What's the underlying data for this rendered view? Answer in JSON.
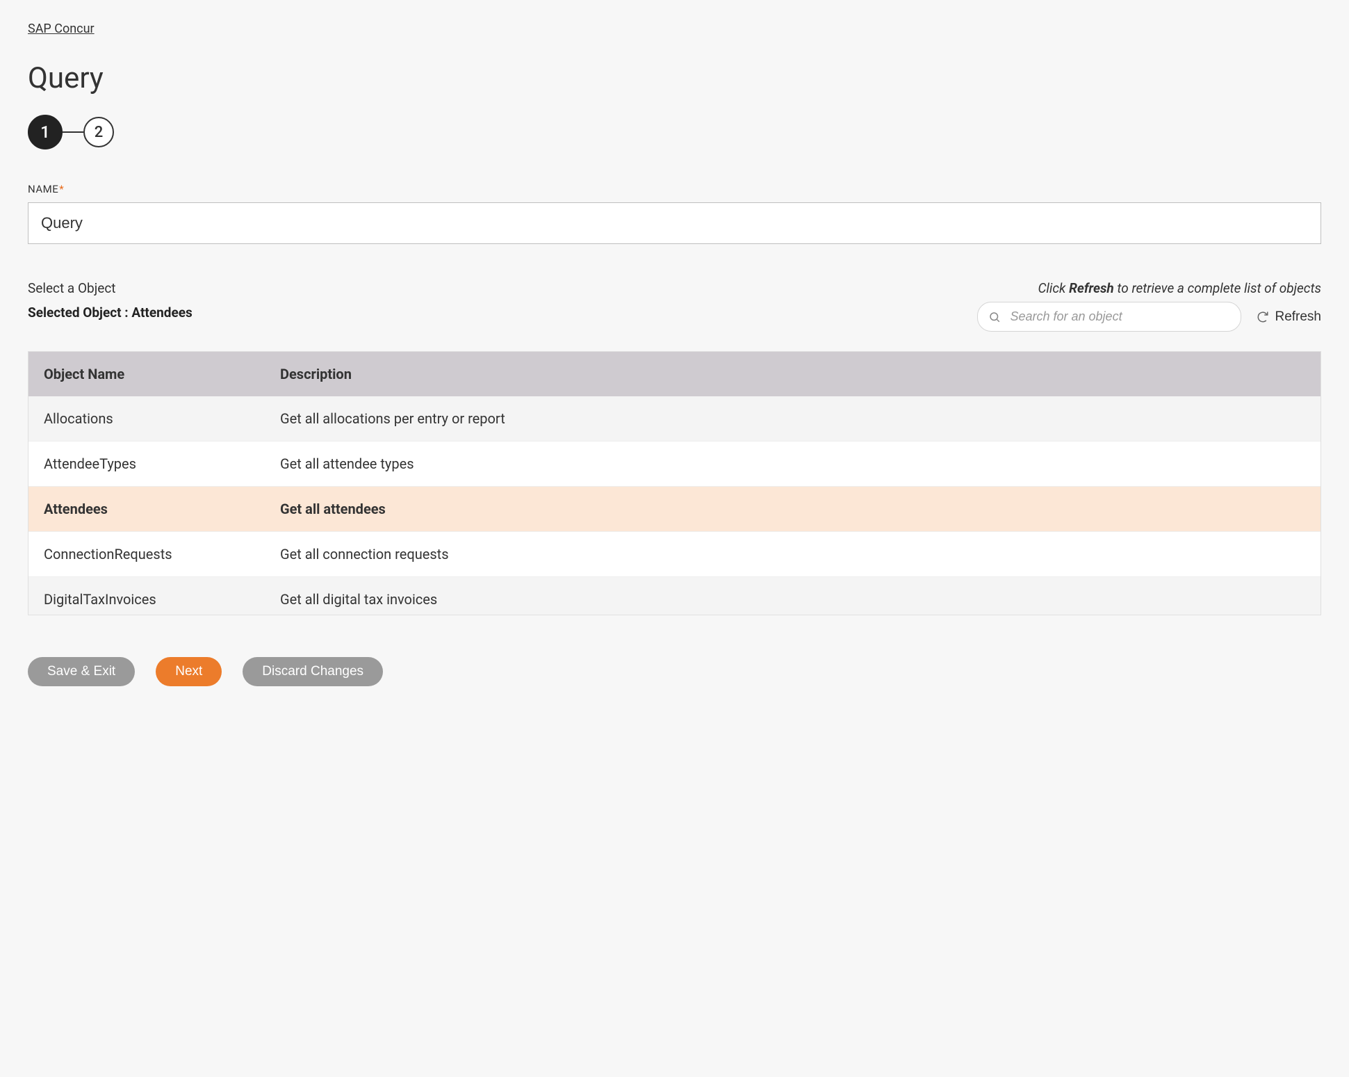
{
  "breadcrumb": {
    "label": "SAP Concur"
  },
  "page": {
    "title": "Query"
  },
  "steps": [
    {
      "num": "1",
      "active": true
    },
    {
      "num": "2",
      "active": false
    }
  ],
  "name_field": {
    "label": "NAME",
    "required_mark": "*",
    "value": "Query"
  },
  "object_section": {
    "select_label": "Select a Object",
    "selected_prefix": "Selected Object : ",
    "selected_name": "Attendees",
    "hint_prefix": "Click ",
    "hint_bold": "Refresh",
    "hint_suffix": " to retrieve a complete list of objects",
    "search_placeholder": "Search for an object",
    "refresh_label": "Refresh"
  },
  "table": {
    "headers": {
      "name": "Object Name",
      "description": "Description"
    },
    "rows": [
      {
        "name": "Allocations",
        "description": "Get all allocations per entry or report",
        "selected": false
      },
      {
        "name": "AttendeeTypes",
        "description": "Get all attendee types",
        "selected": false
      },
      {
        "name": "Attendees",
        "description": "Get all attendees",
        "selected": true
      },
      {
        "name": "ConnectionRequests",
        "description": "Get all connection requests",
        "selected": false
      },
      {
        "name": "DigitalTaxInvoices",
        "description": "Get all digital tax invoices",
        "selected": false
      }
    ]
  },
  "actions": {
    "save_exit": "Save & Exit",
    "next": "Next",
    "discard": "Discard Changes"
  }
}
